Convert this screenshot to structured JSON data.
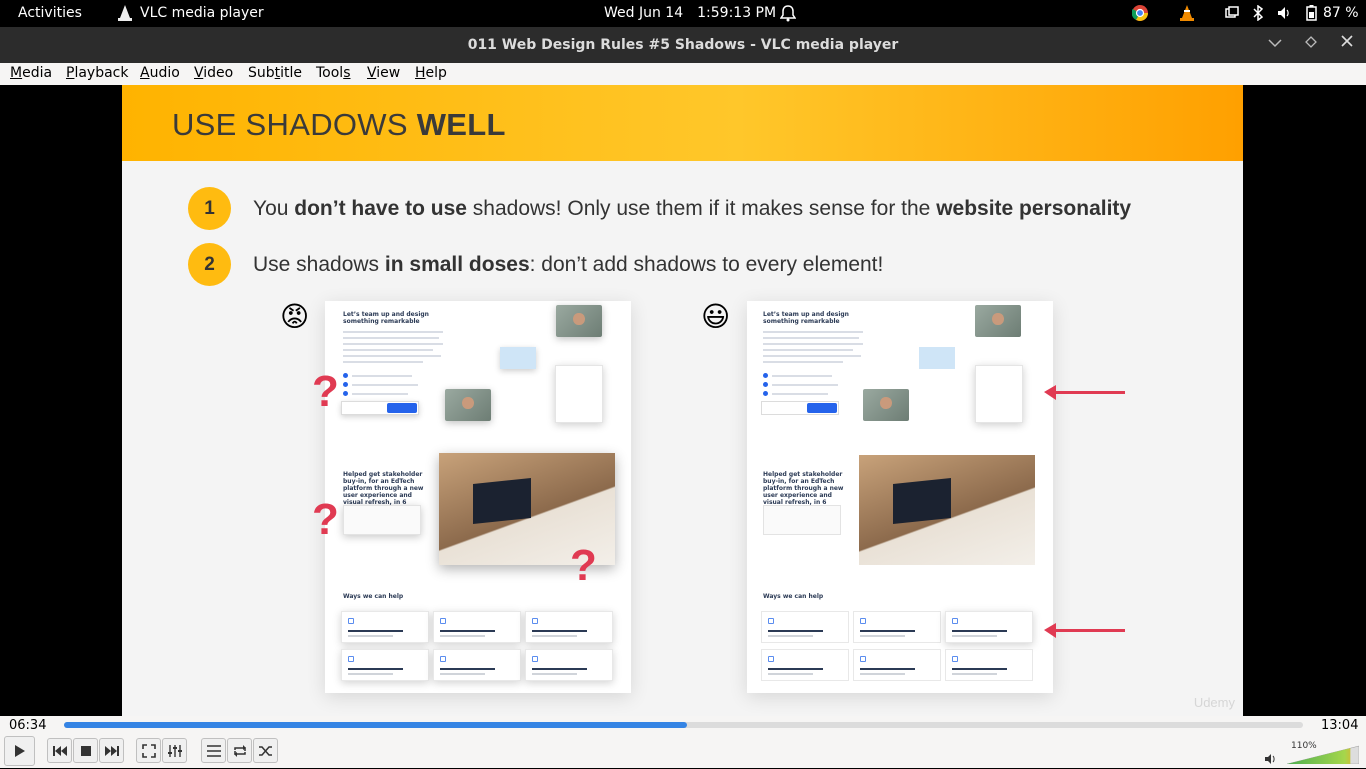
{
  "topbar": {
    "activities": "Activities",
    "app_name": "VLC media player",
    "date": "Wed Jun 14",
    "time": "1:59:13 PM",
    "battery": "87 %"
  },
  "window": {
    "title": "011 Web Design Rules #5 Shadows - VLC media player"
  },
  "menu": {
    "items": [
      {
        "pre": "",
        "u": "M",
        "post": "edia"
      },
      {
        "pre": "",
        "u": "P",
        "post": "layback"
      },
      {
        "pre": "",
        "u": "A",
        "post": "udio"
      },
      {
        "pre": "",
        "u": "V",
        "post": "ideo"
      },
      {
        "pre": "Sub",
        "u": "t",
        "post": "itle"
      },
      {
        "pre": "Tool",
        "u": "s",
        "post": ""
      },
      {
        "pre": "",
        "u": "V",
        "post": "iew"
      },
      {
        "pre": "",
        "u": "H",
        "post": "elp"
      }
    ]
  },
  "slide": {
    "title_normal": "USE SHADOWS ",
    "title_bold": "WELL",
    "points": [
      {
        "num": "1",
        "a": "You ",
        "b": "don’t have to use",
        "c": " shadows! Only use them if it makes sense for the ",
        "d": "website personality"
      },
      {
        "num": "2",
        "a": "Use shadows ",
        "b": "in small doses",
        "c": ": don’t add shadows to every element!",
        "d": ""
      }
    ],
    "emoji_bad": "😡",
    "emoji_good": "😃",
    "question_mark": "?",
    "mock": {
      "heading": "Let’s team up and design something remarkable",
      "case_heading": "Helped get stakeholder buy-in, for an EdTech platform through a new user experience and visual refresh, in 6 weeks",
      "ways": "Ways we can help",
      "signup": "Get in touch"
    },
    "watermark": "Udemy"
  },
  "player": {
    "elapsed": "06:34",
    "total": "13:04",
    "progress": 0.503,
    "volume_label": "110%",
    "volume": 1.1
  }
}
